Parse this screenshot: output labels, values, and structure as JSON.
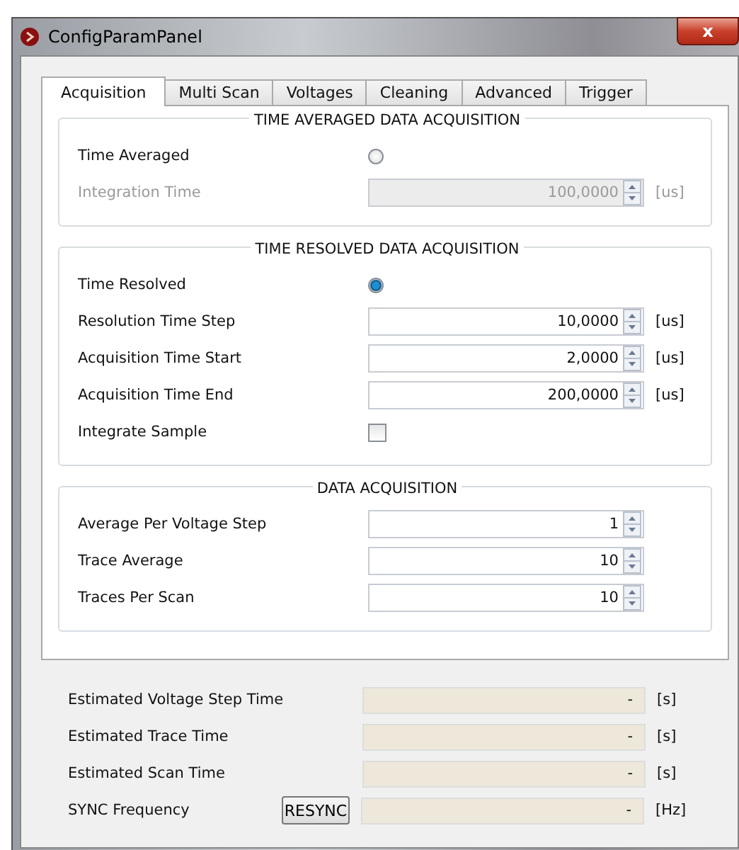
{
  "window": {
    "title": "ConfigParamPanel",
    "close": "x"
  },
  "tabs": [
    {
      "label": "Acquisition",
      "selected": true
    },
    {
      "label": "Multi Scan",
      "selected": false
    },
    {
      "label": "Voltages",
      "selected": false
    },
    {
      "label": "Cleaning",
      "selected": false
    },
    {
      "label": "Advanced",
      "selected": false
    },
    {
      "label": "Trigger",
      "selected": false
    }
  ],
  "groups": [
    {
      "title": "TIME AVERAGED DATA ACQUISITION",
      "rows": [
        {
          "kind": "radio",
          "label": "Time Averaged",
          "selected": false,
          "disabled": false
        },
        {
          "kind": "spin",
          "label": "Integration Time",
          "value": "100,0000",
          "unit": "[us]",
          "disabled": true
        }
      ]
    },
    {
      "title": "TIME RESOLVED DATA ACQUISITION",
      "rows": [
        {
          "kind": "radio",
          "label": "Time Resolved",
          "selected": true,
          "disabled": false
        },
        {
          "kind": "spin",
          "label": "Resolution Time Step",
          "value": "10,0000",
          "unit": "[us]",
          "disabled": false
        },
        {
          "kind": "spin",
          "label": "Acquisition Time Start",
          "value": "2,0000",
          "unit": "[us]",
          "disabled": false
        },
        {
          "kind": "spin",
          "label": "Acquisition Time End",
          "value": "200,0000",
          "unit": "[us]",
          "disabled": false
        },
        {
          "kind": "checkbox",
          "label": "Integrate Sample",
          "checked": false,
          "disabled": false
        }
      ]
    },
    {
      "title": "DATA ACQUISITION",
      "rows": [
        {
          "kind": "spin",
          "label": "Average Per Voltage Step",
          "value": "1",
          "unit": "",
          "disabled": false
        },
        {
          "kind": "spin",
          "label": "Trace Average",
          "value": "10",
          "unit": "",
          "disabled": false
        },
        {
          "kind": "spin",
          "label": "Traces Per Scan",
          "value": "10",
          "unit": "",
          "disabled": false
        }
      ]
    }
  ],
  "estimates": [
    {
      "label": "Estimated Voltage Step Time",
      "value": "-",
      "unit": "[s]"
    },
    {
      "label": "Estimated Trace Time",
      "value": "-",
      "unit": "[s]"
    },
    {
      "label": "Estimated Scan Time",
      "value": "-",
      "unit": "[s]"
    },
    {
      "label": "SYNC Frequency",
      "button": "RESYNC",
      "value": "-",
      "unit": "[Hz]"
    }
  ]
}
